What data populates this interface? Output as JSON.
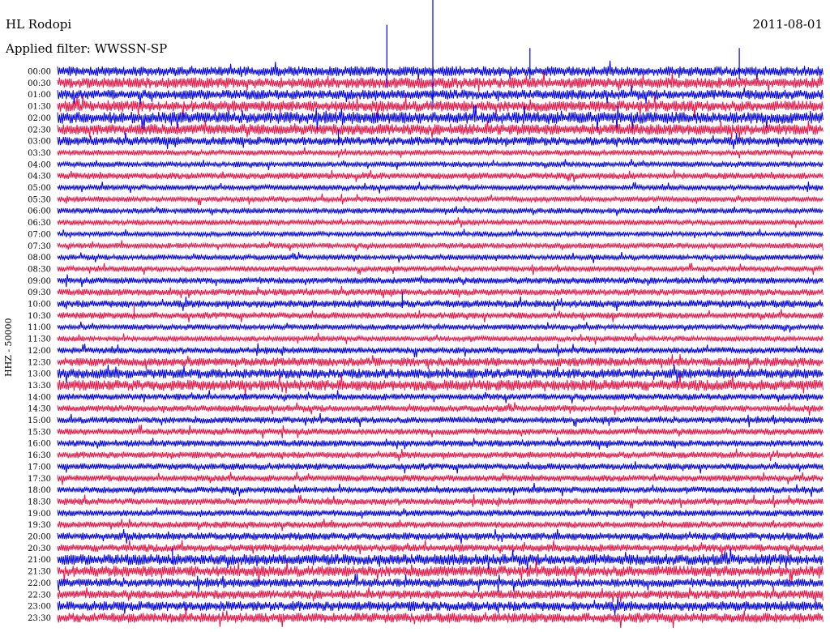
{
  "header": {
    "station": "HL Rodopi",
    "date": "2011-08-01",
    "filter": "Applied filter: WWSSN-SP"
  },
  "chart_data": {
    "type": "line",
    "title": "HL Rodopi",
    "subtitle": "Applied filter: WWSSN-SP",
    "date": "2011-08-01",
    "ylabel": "HHZ - 50000",
    "rows": [
      "00:00",
      "00:30",
      "01:00",
      "01:30",
      "02:00",
      "02:30",
      "03:00",
      "03:30",
      "04:00",
      "04:30",
      "05:00",
      "05:30",
      "06:00",
      "06:30",
      "07:00",
      "07:30",
      "08:00",
      "08:30",
      "09:00",
      "09:30",
      "10:00",
      "10:30",
      "11:00",
      "11:30",
      "12:00",
      "12:30",
      "13:00",
      "13:30",
      "14:00",
      "14:30",
      "15:00",
      "15:30",
      "16:00",
      "16:30",
      "17:00",
      "17:30",
      "18:00",
      "18:30",
      "19:00",
      "19:30",
      "20:00",
      "20:30",
      "21:00",
      "21:30",
      "22:00",
      "22:30",
      "23:00",
      "23:30"
    ],
    "row_minutes": 30,
    "trace_colors": [
      "#0000ee",
      "#ee1144"
    ],
    "noise_level": [
      0.9,
      1.0,
      0.9,
      1.0,
      1.1,
      1.0,
      0.8,
      0.5,
      0.5,
      0.6,
      0.5,
      0.5,
      0.5,
      0.5,
      0.45,
      0.5,
      0.5,
      0.5,
      0.6,
      0.6,
      0.7,
      0.6,
      0.5,
      0.5,
      0.6,
      0.8,
      0.9,
      1.0,
      0.6,
      0.6,
      0.6,
      0.6,
      0.6,
      0.6,
      0.6,
      0.6,
      0.6,
      0.6,
      0.6,
      0.6,
      0.7,
      0.7,
      1.0,
      1.0,
      0.8,
      0.8,
      0.9,
      0.9
    ],
    "bursts": [
      {
        "row": 0,
        "minute": 12.9,
        "amplitude": 12
      },
      {
        "row": 0,
        "minute": 14.7,
        "amplitude": 26
      },
      {
        "row": 0,
        "minute": 18.5,
        "amplitude": 6
      },
      {
        "row": 0,
        "minute": 26.7,
        "amplitude": 6
      },
      {
        "row": 6,
        "minute": 11.0,
        "amplitude": 3
      },
      {
        "row": 20,
        "minute": 13.5,
        "amplitude": 3
      },
      {
        "row": 21,
        "minute": 3.0,
        "amplitude": 3
      },
      {
        "row": 42,
        "minute": 4.5,
        "amplitude": 3
      }
    ]
  }
}
